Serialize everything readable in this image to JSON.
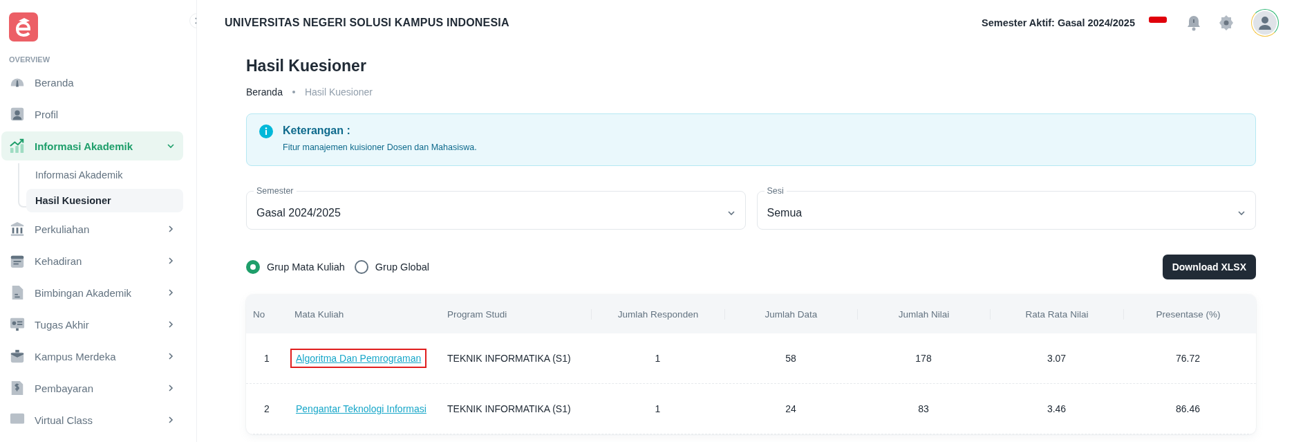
{
  "sidebar": {
    "section": "OVERVIEW",
    "items": [
      {
        "kind": "link",
        "label": "Beranda",
        "selected": false
      },
      {
        "kind": "link",
        "label": "Profil",
        "selected": false
      },
      {
        "kind": "group",
        "label": "Informasi Akademik",
        "selected": true,
        "expanded": true,
        "children": [
          {
            "label": "Informasi Akademik",
            "selected": false
          },
          {
            "label": "Hasil Kuesioner",
            "selected": true
          }
        ]
      },
      {
        "kind": "group",
        "label": "Perkuliahan",
        "selected": false,
        "expanded": false
      },
      {
        "kind": "group",
        "label": "Kehadiran",
        "selected": false,
        "expanded": false
      },
      {
        "kind": "group",
        "label": "Bimbingan Akademik",
        "selected": false,
        "expanded": false
      },
      {
        "kind": "group",
        "label": "Tugas Akhir",
        "selected": false,
        "expanded": false
      },
      {
        "kind": "group",
        "label": "Kampus Merdeka",
        "selected": false,
        "expanded": false
      },
      {
        "kind": "group",
        "label": "Pembayaran",
        "selected": false,
        "expanded": false
      },
      {
        "kind": "group",
        "label": "Virtual Class",
        "selected": false,
        "expanded": false
      }
    ]
  },
  "header": {
    "title": "UNIVERSITAS NEGERI SOLUSI KAMPUS INDONESIA",
    "semester": "Semester Aktif: Gasal 2024/2025"
  },
  "page": {
    "title": "Hasil Kuesioner",
    "breadcrumb": [
      {
        "label": "Beranda",
        "current": false
      },
      {
        "label": "Hasil Kuesioner",
        "current": true
      }
    ]
  },
  "alert": {
    "title": "Keterangan :",
    "text": "Fitur manajemen kuisioner Dosen dan Mahasiswa."
  },
  "filters": [
    {
      "label": "Semester",
      "value": "Gasal 2024/2025"
    },
    {
      "label": "Sesi",
      "value": "Semua"
    }
  ],
  "groups": [
    {
      "label": "Grup Mata Kuliah",
      "selected": true
    },
    {
      "label": "Grup Global",
      "selected": false
    }
  ],
  "download": "Download XLSX",
  "table": {
    "columns": [
      "No",
      "Mata Kuliah",
      "Program Studi",
      "Jumlah Responden",
      "Jumlah Data",
      "Jumlah Nilai",
      "Rata Rata Nilai",
      "Presentase (%)"
    ],
    "rows": [
      {
        "no": "1",
        "course": "Algoritma Dan Pemrograman",
        "highlighted": true,
        "program": "TEKNIK INFORMATIKA (S1)",
        "respondents": "1",
        "data": "58",
        "score": "178",
        "average": "3.07",
        "percent": "76.72"
      },
      {
        "no": "2",
        "course": "Pengantar Teknologi Informasi",
        "highlighted": false,
        "program": "TEKNIK INFORMATIKA (S1)",
        "respondents": "1",
        "data": "24",
        "score": "83",
        "average": "3.46",
        "percent": "86.46"
      }
    ]
  }
}
